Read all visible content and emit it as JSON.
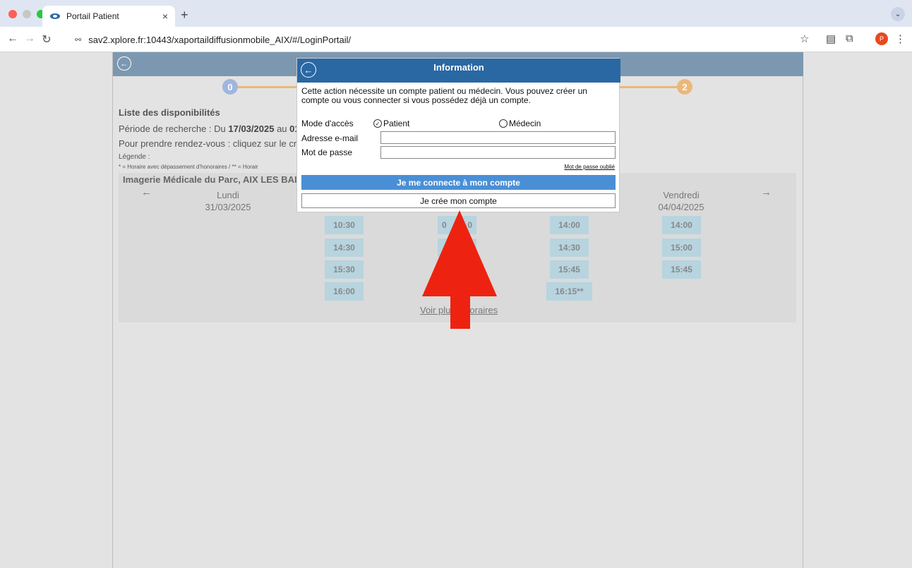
{
  "browser": {
    "tab_title": "Portail Patient",
    "tab_close": "×",
    "new_tab": "+",
    "url": "sav2.xplore.fr:10443/xaportaildiffusionmobile_AIX/#/LoginPortail/",
    "profile_initial": "P",
    "dot_colors": [
      "#ff5f57",
      "#c7c7c7",
      "#28c840"
    ]
  },
  "app": {
    "header_color": "#7c98b1",
    "steps": [
      "0",
      "2"
    ],
    "list_title": "Liste des disponibilités",
    "period_prefix": "Période de recherche :  Du ",
    "period_start": "17/03/2025",
    "period_mid": " au ",
    "period_end": "01",
    "instruction": "Pour prendre rendez-vous : cliquez sur le crén",
    "legend_label": "Légende :",
    "legend_text": "* = Horaire avec dépassement d'honoraires / ** = Horair",
    "center_name": "Imagerie Médicale du Parc, AIX LES BAINS",
    "days": [
      {
        "name": "Lundi",
        "date": "31/03/2025"
      },
      {
        "name": "Vendredi",
        "date": "04/04/2025"
      }
    ],
    "slots": {
      "col2": [
        "10:30",
        "14:30",
        "15:30",
        "16:00"
      ],
      "col3_partial": "0",
      "col3_partial_end": "0",
      "col4": [
        "14:00",
        "14:30",
        "15:45",
        "16:15**"
      ],
      "col5": [
        "14:00",
        "15:00",
        "15:45"
      ]
    },
    "more_link": "Voir plus d'horaires"
  },
  "modal": {
    "title": "Information",
    "header_color": "#2a68a4",
    "message": "Cette action nécessite un compte patient ou médecin. Vous pouvez créer un compte ou vous connecter si vous possédez déjà un compte.",
    "mode_label": "Mode d'accès",
    "option_patient": "Patient",
    "option_medecin": "Médecin",
    "selected_mode": "Patient",
    "email_label": "Adresse e-mail",
    "email_value": "",
    "password_label": "Mot de passe",
    "password_value": "",
    "forgot_link": "Mot de passe oublié",
    "connect_button": "Je me connecte à mon compte",
    "create_button": "Je crée mon compte"
  },
  "annotation": {
    "arrow_color": "#ee2211",
    "arrow_icon": "up-arrow-icon"
  }
}
